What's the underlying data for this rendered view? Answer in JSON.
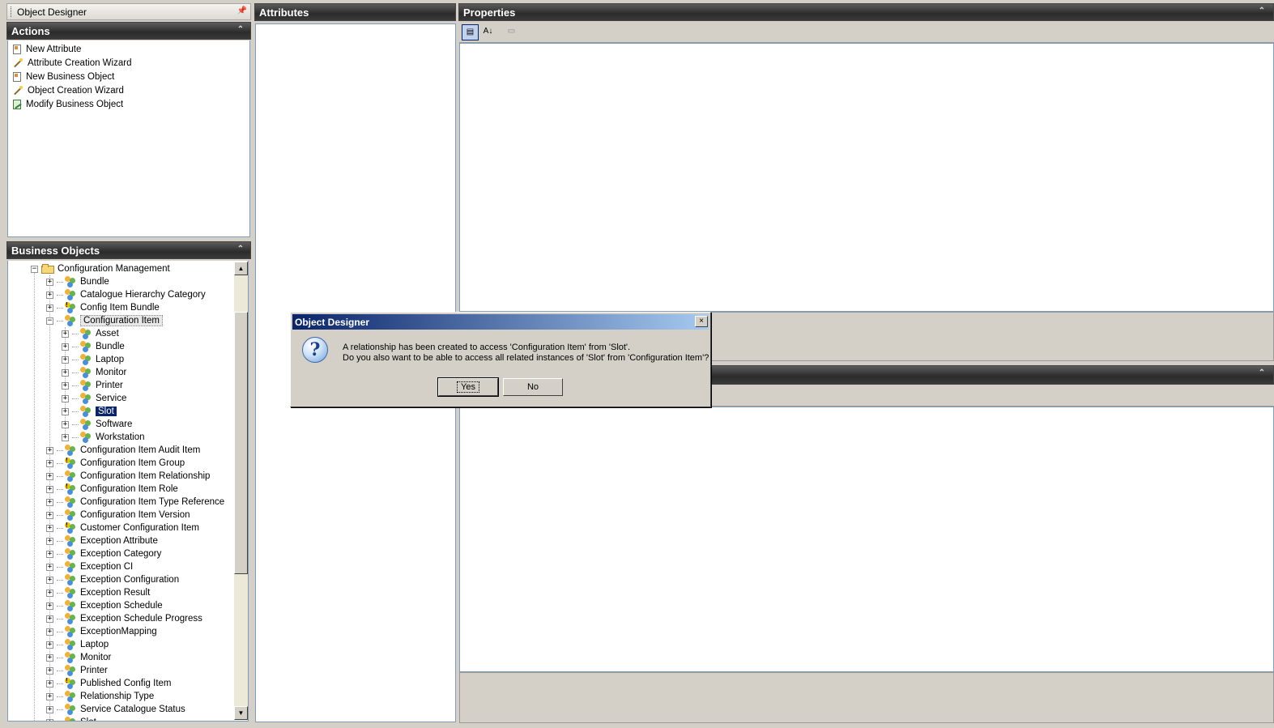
{
  "window": {
    "title": "Object Designer"
  },
  "actions": {
    "header": "Actions",
    "items": [
      {
        "label": "New Attribute",
        "icon": "new-document-icon"
      },
      {
        "label": "Attribute Creation Wizard",
        "icon": "wand-icon"
      },
      {
        "label": "New Business Object",
        "icon": "new-document-icon"
      },
      {
        "label": "Object Creation Wizard",
        "icon": "wand-icon"
      },
      {
        "label": "Modify Business Object",
        "icon": "modify-object-icon"
      }
    ]
  },
  "business_objects": {
    "header": "Business Objects",
    "tree": [
      {
        "label": "Configuration Management",
        "level": 0,
        "expanded": true,
        "icon": "folder-icon"
      },
      {
        "label": "Bundle",
        "level": 1
      },
      {
        "label": "Catalogue Hierarchy Category",
        "level": 1
      },
      {
        "label": "Config Item Bundle",
        "level": 1,
        "warn": true
      },
      {
        "label": "Configuration Item",
        "level": 1,
        "expanded": true,
        "highlight": true
      },
      {
        "label": "Asset",
        "level": 2
      },
      {
        "label": "Bundle",
        "level": 2
      },
      {
        "label": "Laptop",
        "level": 2
      },
      {
        "label": "Monitor",
        "level": 2
      },
      {
        "label": "Printer",
        "level": 2
      },
      {
        "label": "Service",
        "level": 2
      },
      {
        "label": "Slot",
        "level": 2,
        "selected": true
      },
      {
        "label": "Software",
        "level": 2
      },
      {
        "label": "Workstation",
        "level": 2
      },
      {
        "label": "Configuration Item Audit Item",
        "level": 1
      },
      {
        "label": "Configuration Item Group",
        "level": 1,
        "warn": true
      },
      {
        "label": "Configuration Item Relationship",
        "level": 1
      },
      {
        "label": "Configuration Item Role",
        "level": 1,
        "warn": true
      },
      {
        "label": "Configuration Item Type Reference",
        "level": 1
      },
      {
        "label": "Configuration Item Version",
        "level": 1
      },
      {
        "label": "Customer Configuration Item",
        "level": 1,
        "warn": true
      },
      {
        "label": "Exception Attribute",
        "level": 1
      },
      {
        "label": "Exception Category",
        "level": 1
      },
      {
        "label": "Exception CI",
        "level": 1
      },
      {
        "label": "Exception Configuration",
        "level": 1
      },
      {
        "label": "Exception Result",
        "level": 1
      },
      {
        "label": "Exception Schedule",
        "level": 1
      },
      {
        "label": "Exception Schedule Progress",
        "level": 1
      },
      {
        "label": "ExceptionMapping",
        "level": 1
      },
      {
        "label": "Laptop",
        "level": 1
      },
      {
        "label": "Monitor",
        "level": 1
      },
      {
        "label": "Printer",
        "level": 1
      },
      {
        "label": "Published Config Item",
        "level": 1,
        "warn": true
      },
      {
        "label": "Relationship Type",
        "level": 1
      },
      {
        "label": "Service Catalogue Status",
        "level": 1
      },
      {
        "label": "Slot",
        "level": 1
      }
    ]
  },
  "attributes": {
    "header": "Attributes"
  },
  "properties": {
    "header": "Properties"
  },
  "dialog": {
    "title": "Object Designer",
    "line1": "A relationship has been created to access 'Configuration Item' from 'Slot'.",
    "line2": "Do you also want to be able to access all related instances of 'Slot' from 'Configuration Item'?",
    "yes": "Yes",
    "no": "No",
    "close": "×"
  },
  "colors": {
    "header_dark": "#2b2b2b",
    "selection": "#0a246a",
    "dialog_title_start": "#0a246a",
    "dialog_title_end": "#a6caf0",
    "panel_bg": "#d4d0c8"
  }
}
